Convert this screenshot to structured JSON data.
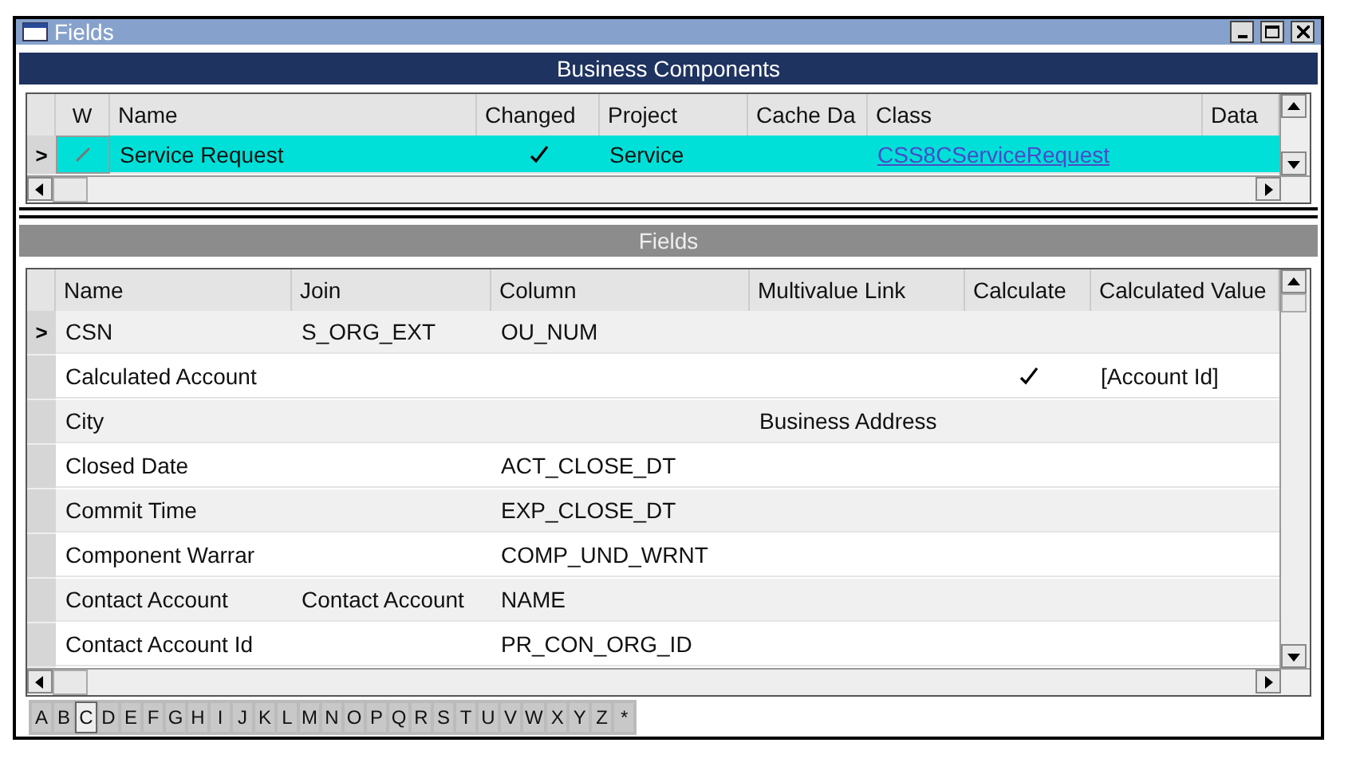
{
  "window": {
    "title": "Fields"
  },
  "business_components": {
    "title": "Business Components",
    "indicator": ">",
    "columns": [
      "W",
      "Name",
      "Changed",
      "Project",
      "Cache Da",
      "Class",
      "Data"
    ],
    "rows": [
      {
        "selected": true,
        "edited": true,
        "name": "Service Request",
        "changed": true,
        "project": "Service",
        "cache_data": "",
        "class": "CSS8CServiceRequest"
      }
    ]
  },
  "fields": {
    "title": "Fields",
    "indicator": ">",
    "columns": [
      "Name",
      "Join",
      "Column",
      "Multivalue Link",
      "Calculate",
      "Calculated Value"
    ],
    "rows": [
      {
        "selected": true,
        "name": "CSN",
        "join": "S_ORG_EXT",
        "column": "OU_NUM",
        "multivalue_link": "",
        "calculate": false,
        "calculated_value": ""
      },
      {
        "selected": false,
        "name": "Calculated Account",
        "join": "",
        "column": "",
        "multivalue_link": "",
        "calculate": true,
        "calculated_value": "[Account Id]"
      },
      {
        "selected": false,
        "name": "City",
        "join": "",
        "column": "",
        "multivalue_link": "Business Address",
        "calculate": false,
        "calculated_value": ""
      },
      {
        "selected": false,
        "name": "Closed Date",
        "join": "",
        "column": "ACT_CLOSE_DT",
        "multivalue_link": "",
        "calculate": false,
        "calculated_value": ""
      },
      {
        "selected": false,
        "name": "Commit Time",
        "join": "",
        "column": "EXP_CLOSE_DT",
        "multivalue_link": "",
        "calculate": false,
        "calculated_value": ""
      },
      {
        "selected": false,
        "name": "Component Warrar",
        "join": "",
        "column": "COMP_UND_WRNT",
        "multivalue_link": "",
        "calculate": false,
        "calculated_value": ""
      },
      {
        "selected": false,
        "name": "Contact Account",
        "join": "Contact Account",
        "column": "NAME",
        "multivalue_link": "",
        "calculate": false,
        "calculated_value": ""
      },
      {
        "selected": false,
        "name": "Contact Account Id",
        "join": "",
        "column": "PR_CON_ORG_ID",
        "multivalue_link": "",
        "calculate": false,
        "calculated_value": ""
      }
    ]
  },
  "alphabet": [
    {
      "label": "A",
      "selected": false
    },
    {
      "label": "B",
      "selected": false
    },
    {
      "label": "C",
      "selected": true
    },
    {
      "label": "D",
      "selected": false
    },
    {
      "label": "E",
      "selected": false
    },
    {
      "label": "F",
      "selected": false
    },
    {
      "label": "G",
      "selected": false
    },
    {
      "label": "H",
      "selected": false
    },
    {
      "label": "I",
      "selected": false
    },
    {
      "label": "J",
      "selected": false
    },
    {
      "label": "K",
      "selected": false
    },
    {
      "label": "L",
      "selected": false
    },
    {
      "label": "M",
      "selected": false
    },
    {
      "label": "N",
      "selected": false
    },
    {
      "label": "O",
      "selected": false
    },
    {
      "label": "P",
      "selected": false
    },
    {
      "label": "Q",
      "selected": false
    },
    {
      "label": "R",
      "selected": false
    },
    {
      "label": "S",
      "selected": false
    },
    {
      "label": "T",
      "selected": false
    },
    {
      "label": "U",
      "selected": false
    },
    {
      "label": "V",
      "selected": false
    },
    {
      "label": "W",
      "selected": false
    },
    {
      "label": "X",
      "selected": false
    },
    {
      "label": "Y",
      "selected": false
    },
    {
      "label": "Z",
      "selected": false
    },
    {
      "label": "*",
      "selected": false
    }
  ]
}
